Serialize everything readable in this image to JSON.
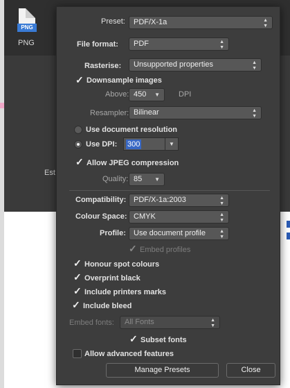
{
  "background": {
    "format_label": "PNG",
    "format_tag": "PNG",
    "partial_text": "Est"
  },
  "export": {
    "preset": {
      "label": "Preset:",
      "value": "PDF/X-1a"
    },
    "file_format": {
      "label": "File format:",
      "value": "PDF"
    },
    "rasterise": {
      "label": "Rasterise:",
      "value": "Unsupported properties"
    },
    "downsample": {
      "label": "Downsample images",
      "checked": true
    },
    "above": {
      "label": "Above:",
      "value": "450",
      "unit": "DPI"
    },
    "resampler": {
      "label": "Resampler:",
      "value": "Bilinear"
    },
    "use_doc_res": {
      "label": "Use document resolution",
      "selected": false
    },
    "use_dpi": {
      "label": "Use DPI:",
      "selected": true,
      "value": "300"
    },
    "jpeg": {
      "label": "Allow JPEG compression",
      "checked": true
    },
    "quality": {
      "label": "Quality:",
      "value": "85"
    },
    "compatibility": {
      "label": "Compatibility:",
      "value": "PDF/X-1a:2003"
    },
    "colour_space": {
      "label": "Colour Space:",
      "value": "CMYK"
    },
    "profile": {
      "label": "Profile:",
      "value": "Use document profile"
    },
    "embed_profiles": {
      "label": "Embed profiles",
      "checked": true,
      "enabled": false
    },
    "honour_spot": {
      "label": "Honour spot colours",
      "checked": true
    },
    "overprint": {
      "label": "Overprint black",
      "checked": true
    },
    "printers_marks": {
      "label": "Include printers marks",
      "checked": true
    },
    "bleed": {
      "label": "Include bleed",
      "checked": true
    },
    "embed_fonts": {
      "label": "Embed fonts:",
      "value": "All Fonts",
      "enabled": false
    },
    "subset_fonts": {
      "label": "Subset fonts",
      "checked": true
    },
    "advanced": {
      "label": "Allow advanced features",
      "checked": false
    }
  },
  "buttons": {
    "manage_presets": "Manage Presets",
    "close": "Close"
  },
  "colors": {
    "dialog_bg": "#3d3d3d",
    "accent": "#3968c4"
  }
}
